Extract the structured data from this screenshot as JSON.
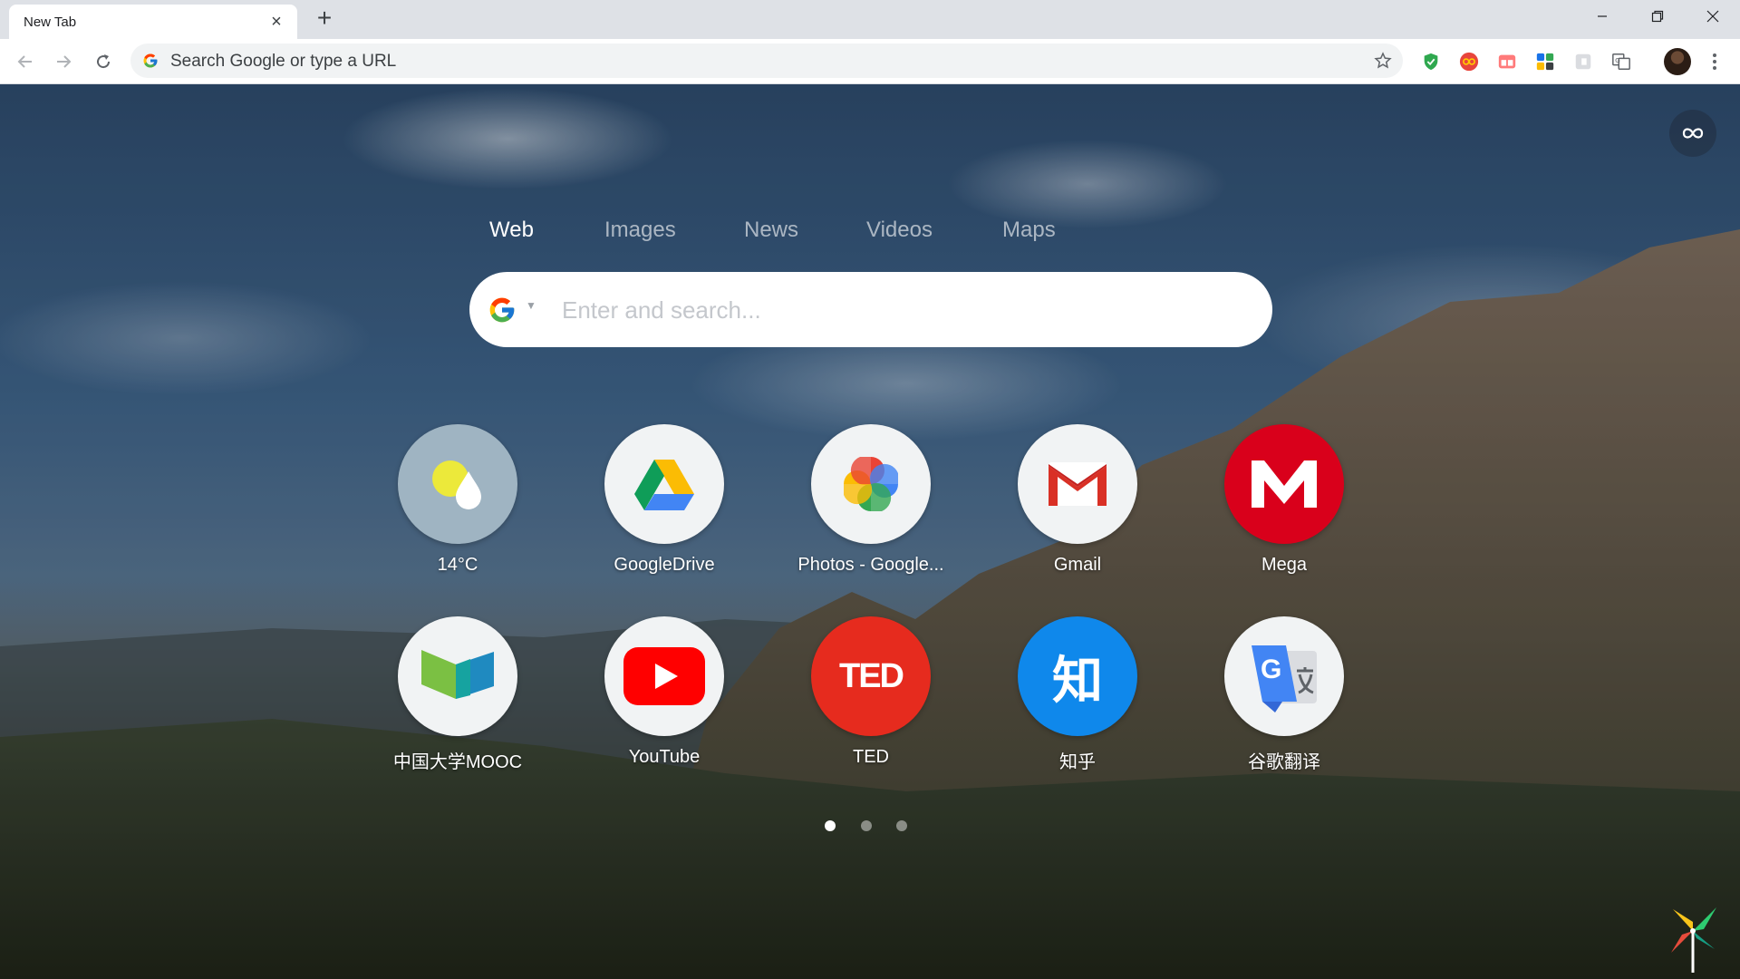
{
  "browser": {
    "tab_title": "New Tab",
    "omnibox_placeholder": "Search Google or type a URL"
  },
  "search": {
    "tabs": [
      "Web",
      "Images",
      "News",
      "Videos",
      "Maps"
    ],
    "active_tab": "Web",
    "placeholder": "Enter and search..."
  },
  "shortcuts": [
    {
      "label": "14°C",
      "icon": "weather-icon"
    },
    {
      "label": "GoogleDrive",
      "icon": "google-drive-icon"
    },
    {
      "label": "Photos - Google...",
      "icon": "google-photos-icon"
    },
    {
      "label": "Gmail",
      "icon": "gmail-icon"
    },
    {
      "label": "Mega",
      "icon": "mega-icon"
    },
    {
      "label": "中国大学MOOC",
      "icon": "mooc-icon"
    },
    {
      "label": "YouTube",
      "icon": "youtube-icon"
    },
    {
      "label": "TED",
      "icon": "ted-icon"
    },
    {
      "label": "知乎",
      "icon": "zhihu-icon"
    },
    {
      "label": "谷歌翻译",
      "icon": "google-translate-icon"
    }
  ],
  "icon_text": {
    "ted": "TED",
    "zhihu": "知"
  },
  "pagination": {
    "pages": 3,
    "current": 1
  },
  "colors": {
    "mega_red": "#d9001b",
    "ted_red": "#e62b1e",
    "zhihu_blue": "#0f88eb",
    "youtube_red": "#ff0000",
    "weather_bg": "#9fb4c2"
  }
}
